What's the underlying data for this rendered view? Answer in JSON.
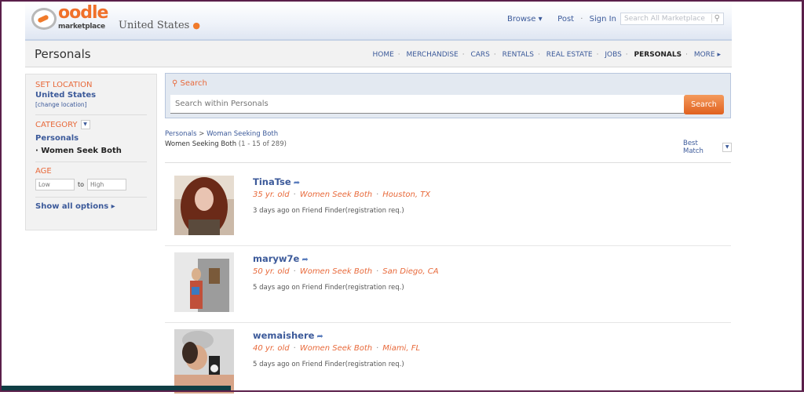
{
  "header": {
    "logo_word": "oodle",
    "logo_sub": "marketplace",
    "location": "United States",
    "links": {
      "browse": "Browse ▾",
      "post": "Post",
      "sign_in": "Sign In"
    },
    "search_placeholder": "Search All Marketplace",
    "search_icon": "magnifier-icon"
  },
  "nav": {
    "page_title": "Personals",
    "items": [
      "HOME",
      "MERCHANDISE",
      "CARS",
      "RENTALS",
      "REAL ESTATE",
      "JOBS",
      "PERSONALS",
      "MORE ▸"
    ],
    "active": "PERSONALS"
  },
  "sidebar": {
    "location_heading": "SET LOCATION",
    "location_value": "United States",
    "change_location": "[change location]",
    "category_heading": "CATEGORY",
    "category_value": "Personals",
    "subcategory": "·  Women Seek Both",
    "age_heading": "AGE",
    "age_low_placeholder": "Low",
    "age_to": "to",
    "age_high_placeholder": "High",
    "show_all": "Show all options ▸"
  },
  "search_panel": {
    "label": "Search",
    "placeholder": "Search within Personals",
    "button": "Search"
  },
  "results": {
    "breadcrumb_root": "Personals",
    "breadcrumb_sep": " > ",
    "breadcrumb_leaf": "Woman Seeking Both",
    "title": "Women Seeking Both",
    "range": " (1 - 15 of 289)",
    "sort_label": "Best Match",
    "listings": [
      {
        "name": "TinaTse",
        "age": "35 yr. old",
        "category": "Women Seek Both",
        "location": "Houston, TX",
        "posted": "3 days ago on Friend Finder(registration req.)"
      },
      {
        "name": "maryw7e",
        "age": "50 yr. old",
        "category": "Women Seek Both",
        "location": "San Diego, CA",
        "posted": "5 days ago on Friend Finder(registration req.)"
      },
      {
        "name": "wemaishere",
        "age": "40 yr. old",
        "category": "Women Seek Both",
        "location": "Miami, FL",
        "posted": "5 days ago on Friend Finder(registration req.)"
      }
    ]
  },
  "colors": {
    "accent_orange": "#e8693a",
    "link_blue": "#3c5a9a",
    "frame": "#5a1f4a"
  }
}
